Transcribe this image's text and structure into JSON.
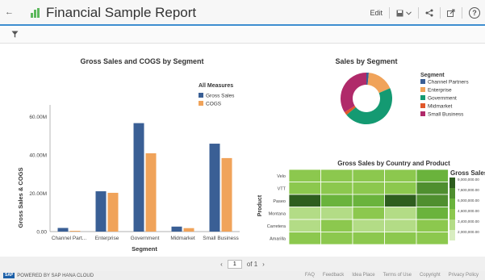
{
  "header": {
    "back_icon": "back-arrow-icon",
    "app_icon": "report-chart-icon",
    "title": "Financial Sample Report",
    "edit_label": "Edit",
    "save_icon": "save-icon",
    "share_icon": "share-icon",
    "export_icon": "export-icon",
    "help_icon": "help-icon"
  },
  "filter_icon": "filter-icon",
  "bar_chart": {
    "chart_data": {
      "type": "bar",
      "title": "Gross Sales and COGS by Segment",
      "xlabel": "Segment",
      "ylabel": "Gross Sales & COGS",
      "categories": [
        "Channel Part...",
        "Enterprise",
        "Government",
        "Midmarket",
        "Small Business"
      ],
      "series": [
        {
          "name": "Gross Sales",
          "color": "#3a5f95",
          "values": [
            1.9,
            21.0,
            56.5,
            2.6,
            45.8
          ]
        },
        {
          "name": "COGS",
          "color": "#f0a35a",
          "values": [
            0.4,
            20.2,
            40.8,
            1.8,
            38.3
          ]
        }
      ],
      "ylim": [
        0,
        66
      ],
      "yticks": [
        "0.00",
        "20.00M",
        "40.00M",
        "60.00M"
      ],
      "legend_title": "All Measures",
      "legend_position": "top-right",
      "grid": false
    }
  },
  "donut_chart": {
    "chart_data": {
      "type": "pie",
      "title": "Sales by Segment",
      "legend_title": "Segment",
      "legend_position": "right",
      "categories": [
        "Channel Partners",
        "Enterprise",
        "Government",
        "Midmarket",
        "Small Business"
      ],
      "values": [
        1.5,
        17.0,
        45.5,
        2.0,
        34.0
      ],
      "colors": [
        "#3a5f95",
        "#f0a35a",
        "#149a72",
        "#e0572a",
        "#b02a6a"
      ]
    }
  },
  "heatmap": {
    "chart_data": {
      "type": "heatmap",
      "title": "Gross Sales by Country and Product",
      "ylabel": "Product",
      "rows": [
        "Velo",
        "VTT",
        "Paseo",
        "Montana",
        "Carretera",
        "Amarilla"
      ],
      "legend_title": "Gross Sales",
      "legend_values": [
        "9,000,000.00",
        "7,600,000.00",
        "6,000,000.00",
        "4,600,000.00",
        "3,400,000.00",
        "2,000,000.00"
      ],
      "legend_colors": [
        "#2e5e1e",
        "#4f8f2f",
        "#6ab33c",
        "#8cc84e",
        "#b3dc86",
        "#d8edc0"
      ],
      "values": [
        [
          4.6,
          4.6,
          4.6,
          4.6,
          6.2
        ],
        [
          4.6,
          4.6,
          4.6,
          4.6,
          7.4
        ],
        [
          9.0,
          6.2,
          6.2,
          9.0,
          7.6
        ],
        [
          3.4,
          3.4,
          4.6,
          3.4,
          6.2
        ],
        [
          3.4,
          4.6,
          3.0,
          3.4,
          4.6
        ],
        [
          4.6,
          4.6,
          4.6,
          4.6,
          4.6
        ]
      ]
    }
  },
  "pager": {
    "prev_icon": "chevron-left-icon",
    "page": "1",
    "of_label": "of 1",
    "next_icon": "chevron-right-icon"
  },
  "footer": {
    "logo": "SAP",
    "powered": "POWERED BY SAP HANA CLOUD",
    "links": [
      "FAQ",
      "Feedback",
      "Idea Place",
      "Terms of Use",
      "Copyright",
      "Privacy Policy"
    ]
  }
}
